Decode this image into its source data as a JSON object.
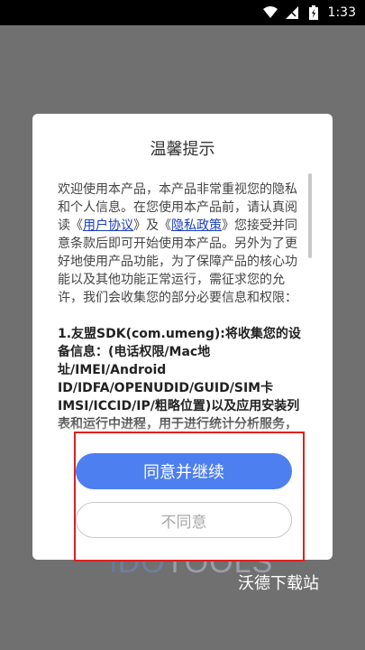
{
  "status_bar": {
    "time": "1:33"
  },
  "dialog": {
    "title": "温馨提示",
    "intro_1": "欢迎使用本产品，本产品非常重视您的隐私和个人信息。在您使用本产品前，请认真阅读《",
    "link_user_agreement": "用户协议",
    "intro_2": "》及《",
    "link_privacy": "隐私政策",
    "intro_3": "》您接受并同意条款后即可开始使用本产品。另外为了更好地使用产品功能，为了保障产品的核心功能以及其他功能正常运行，需征求您的允许，我们会收集您的部分必要信息和权限：",
    "section_1": "1.友盟SDK(com.umeng):将收集您的设备信息：(电话权限/Mac地址/IMEI/Android ID/IDFA/OPENUDID/GUID/SIM卡IMSI/ICCID/IP/粗略位置)以及应用安装列表和运行中进程，用于进行统计分析服务，提供基础反作弊能",
    "agree_button": "同意并继续",
    "disagree_button": "不同意"
  },
  "watermark": {
    "brand": "iDOTOOLS",
    "site": "沃德下载站"
  },
  "colors": {
    "primary": "#4d7ff0",
    "highlight": "#e02020",
    "link": "#1a3ebf"
  }
}
